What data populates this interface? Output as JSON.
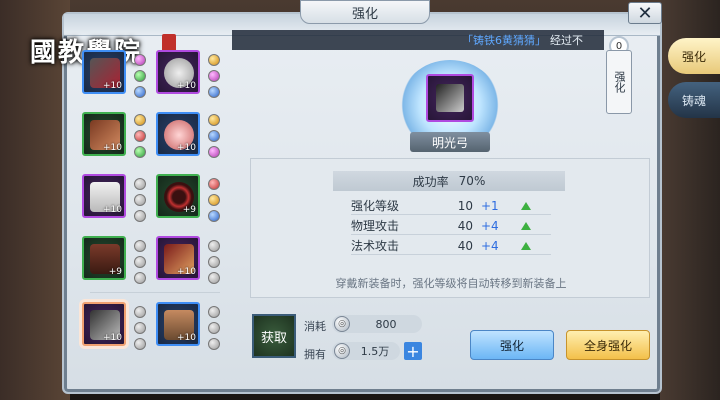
{
  "window": {
    "title": "强化"
  },
  "watermark": {
    "text": "國教學院"
  },
  "marquee": {
    "highlight": "「铸铁6黄猜猜」",
    "text": "经过不"
  },
  "equipment": {
    "slots": [
      {
        "level": "+10"
      },
      {
        "level": "+10"
      },
      {
        "level": "+10"
      },
      {
        "level": "+10"
      },
      {
        "level": "+10"
      },
      {
        "level": "+9"
      },
      {
        "level": "+9"
      },
      {
        "level": "+10"
      },
      {
        "level": "+10"
      },
      {
        "level": "+10"
      }
    ]
  },
  "item": {
    "name": "明光弓"
  },
  "quest": {
    "label": "强化",
    "badge": "0"
  },
  "stats": {
    "rate_label": "成功率",
    "rate_value": "70%",
    "rows": [
      {
        "name": "强化等级",
        "value": "10",
        "inc": "+1"
      },
      {
        "name": "物理攻击",
        "value": "40",
        "inc": "+4"
      },
      {
        "name": "法术攻击",
        "value": "40",
        "inc": "+4"
      }
    ],
    "hint": "穿戴新装备时，强化等级将自动转移到新装备上"
  },
  "resources": {
    "acquire_label": "获取",
    "cost_label": "消耗",
    "cost_value": "800",
    "own_label": "拥有",
    "own_value": "1.5万",
    "plus": "+"
  },
  "actions": {
    "enhance": "强化",
    "enhance_all": "全身强化"
  },
  "side_tabs": [
    {
      "label": "强化"
    },
    {
      "label": "铸魂"
    }
  ],
  "close": "✕"
}
